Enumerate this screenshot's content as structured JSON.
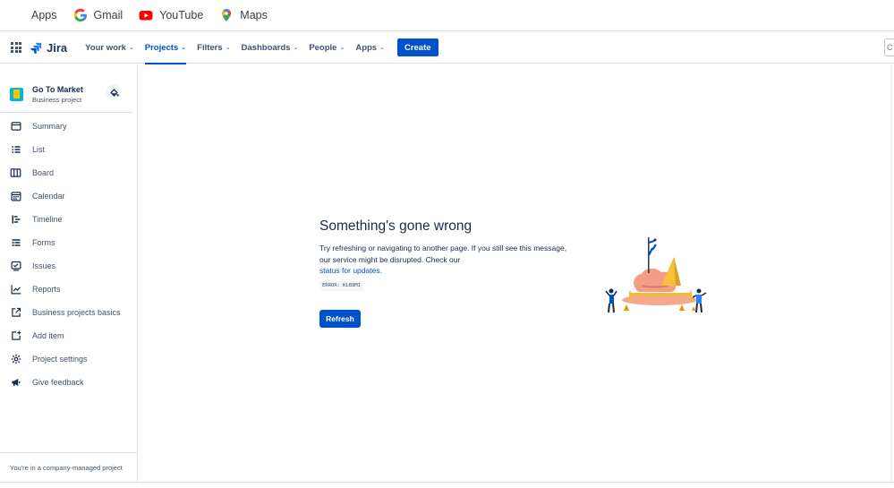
{
  "bookmarks": [
    {
      "label": "Apps",
      "icon": "apps-grid-icon"
    },
    {
      "label": "Gmail",
      "icon": "google-g-icon"
    },
    {
      "label": "YouTube",
      "icon": "youtube-icon"
    },
    {
      "label": "Maps",
      "icon": "maps-pin-icon"
    }
  ],
  "nav": {
    "product": "Jira",
    "items": [
      {
        "label": "Your work",
        "active": false
      },
      {
        "label": "Projects",
        "active": true
      },
      {
        "label": "Filters",
        "active": false
      },
      {
        "label": "Dashboards",
        "active": false
      },
      {
        "label": "People",
        "active": false
      },
      {
        "label": "Apps",
        "active": false
      }
    ],
    "create_label": "Create",
    "search_stub": "C"
  },
  "project": {
    "name": "Go To Market",
    "type": "Business project"
  },
  "sidebar": {
    "items": [
      {
        "label": "Summary",
        "icon": "summary-icon"
      },
      {
        "label": "List",
        "icon": "list-icon"
      },
      {
        "label": "Board",
        "icon": "board-icon"
      },
      {
        "label": "Calendar",
        "icon": "calendar-icon"
      },
      {
        "label": "Timeline",
        "icon": "timeline-icon"
      },
      {
        "label": "Forms",
        "icon": "forms-icon"
      },
      {
        "label": "Issues",
        "icon": "issues-icon"
      },
      {
        "label": "Reports",
        "icon": "reports-icon"
      },
      {
        "label": "Business projects basics",
        "icon": "external-link-icon"
      },
      {
        "label": "Add item",
        "icon": "add-item-icon"
      },
      {
        "label": "Project settings",
        "icon": "gear-icon"
      },
      {
        "label": "Give feedback",
        "icon": "megaphone-icon"
      }
    ],
    "footer": "You're in a company-managed project"
  },
  "error": {
    "title": "Something's gone wrong",
    "body_line1": "Try refreshing or navigating to another page. If you still see this message,",
    "body_line2": "our service might be disrupted. Check our",
    "link_text": "status for updates.",
    "code": "ERROR: KLB8MI",
    "refresh_label": "Refresh"
  },
  "colors": {
    "brand_blue": "#0052cc",
    "text": "#172b4d",
    "subtle": "#42526e"
  }
}
